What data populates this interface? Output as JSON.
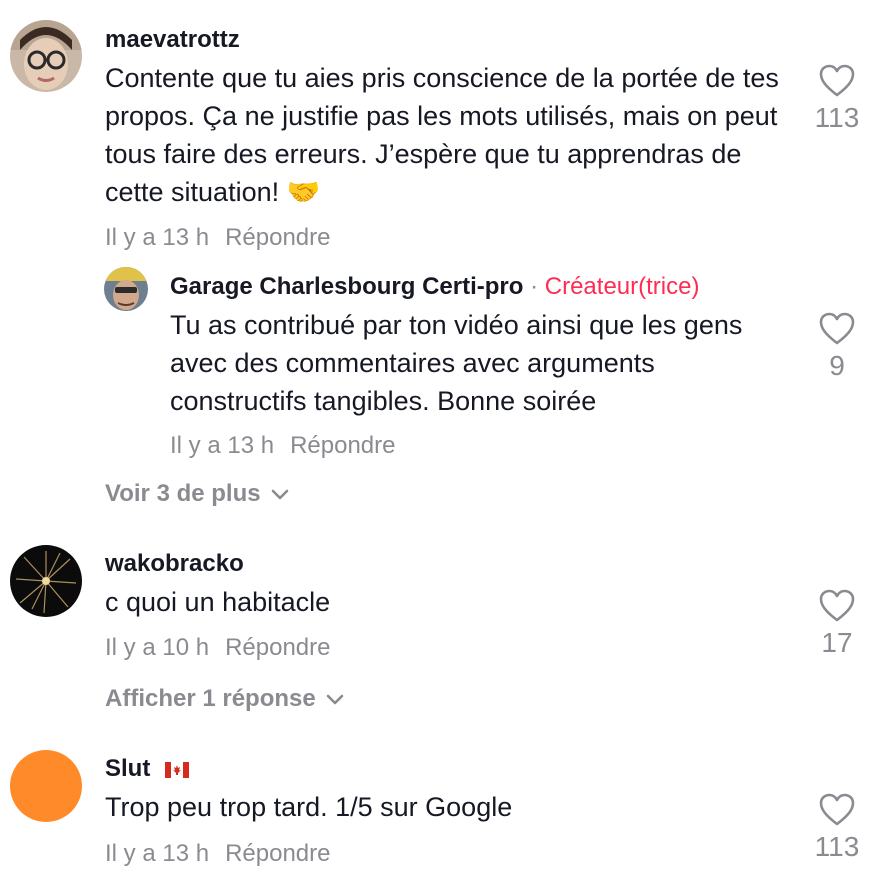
{
  "comments": [
    {
      "username": "maevatrottz",
      "text": "Contente que tu aies pris conscience de la portée de tes propos. Ça ne justifie pas les mots utilisés, mais on peut tous faire des erreurs. J’espère que tu apprendras de cette situation! 🤝",
      "time": "Il y a 13 h",
      "reply_label": "Répondre",
      "likes": "113",
      "reply": {
        "username": "Garage Charlesbourg Certi-pro",
        "separator": "·",
        "creator_badge": "Créateur(trice)",
        "text": "Tu as contribué par ton vidéo ainsi que les gens avec des commentaires avec arguments constructifs tangibles. Bonne soirée",
        "time": "Il y a 13 h",
        "reply_label": "Répondre",
        "likes": "9"
      },
      "more_label": "Voir 3 de plus"
    },
    {
      "username": "wakobracko",
      "text": "c quoi un habitacle",
      "time": "Il y a 10 h",
      "reply_label": "Répondre",
      "likes": "17",
      "more_label": "Afficher 1 réponse"
    },
    {
      "username": "Slut",
      "flag": "canada-flag",
      "text": "Trop peu trop tard. 1/5 sur Google",
      "time": "Il y a 13 h",
      "reply_label": "Répondre",
      "likes": "113"
    }
  ],
  "colors": {
    "text": "#161823",
    "muted": "#8a8b91",
    "creator": "#fe2c55",
    "avatar_orange": "#ff8a2a"
  }
}
